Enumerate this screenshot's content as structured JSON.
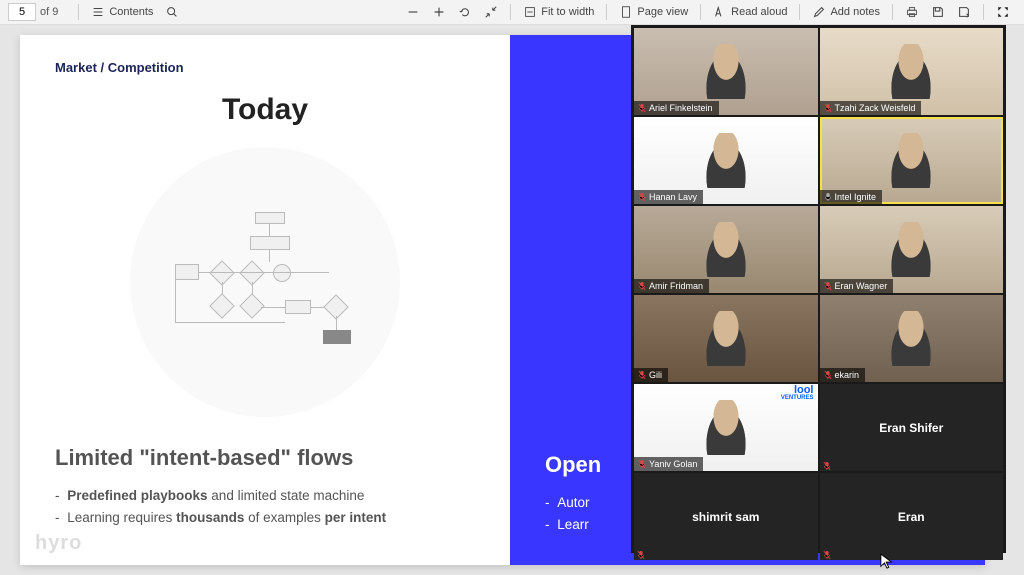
{
  "toolbar": {
    "page_current": "5",
    "page_total": "of 9",
    "contents": "Contents",
    "fit_to_width": "Fit to width",
    "page_view": "Page view",
    "read_aloud": "Read aloud",
    "add_notes": "Add notes"
  },
  "slide": {
    "breadcrumb": "Market / Competition",
    "left": {
      "title": "Today",
      "heading": "Limited \"intent-based\" flows",
      "bullet1_html": "<strong>Predefined playbooks</strong> and limited state machine",
      "bullet2_html": "Learning requires <strong>thousands</strong> of examples <strong>per intent</strong>"
    },
    "right": {
      "heading": "Open ",
      "bullet1": "Autor",
      "bullet2": "Learr"
    },
    "logo": "hyro"
  },
  "zoom": {
    "tiles": [
      {
        "name": "Ariel Finkelstein",
        "muted": true,
        "video": true,
        "bg": "bg1"
      },
      {
        "name": "Tzahi Zack Weisfeld",
        "muted": true,
        "video": true,
        "bg": "bg2"
      },
      {
        "name": "Hanan Lavy",
        "muted": true,
        "video": true,
        "bg": "bg3"
      },
      {
        "name": "Intel Ignite",
        "muted": false,
        "video": true,
        "bg": "bg6",
        "speaking": true
      },
      {
        "name": "Amir Fridman",
        "muted": true,
        "video": true,
        "bg": "bg4"
      },
      {
        "name": "Eran Wagner",
        "muted": true,
        "video": true,
        "bg": "bg6"
      },
      {
        "name": "Gili",
        "muted": true,
        "video": true,
        "bg": "bg5"
      },
      {
        "name": "ekarin",
        "muted": true,
        "video": true,
        "bg": "bg7"
      },
      {
        "name": "Yaniv Golan",
        "muted": true,
        "video": true,
        "bg": "bg3",
        "lool": true
      },
      {
        "name": "Eran Shifer",
        "muted": true,
        "video": false
      },
      {
        "name": "shimrit sam",
        "muted": true,
        "video": false
      },
      {
        "name": "Eran",
        "muted": true,
        "video": false
      }
    ]
  }
}
